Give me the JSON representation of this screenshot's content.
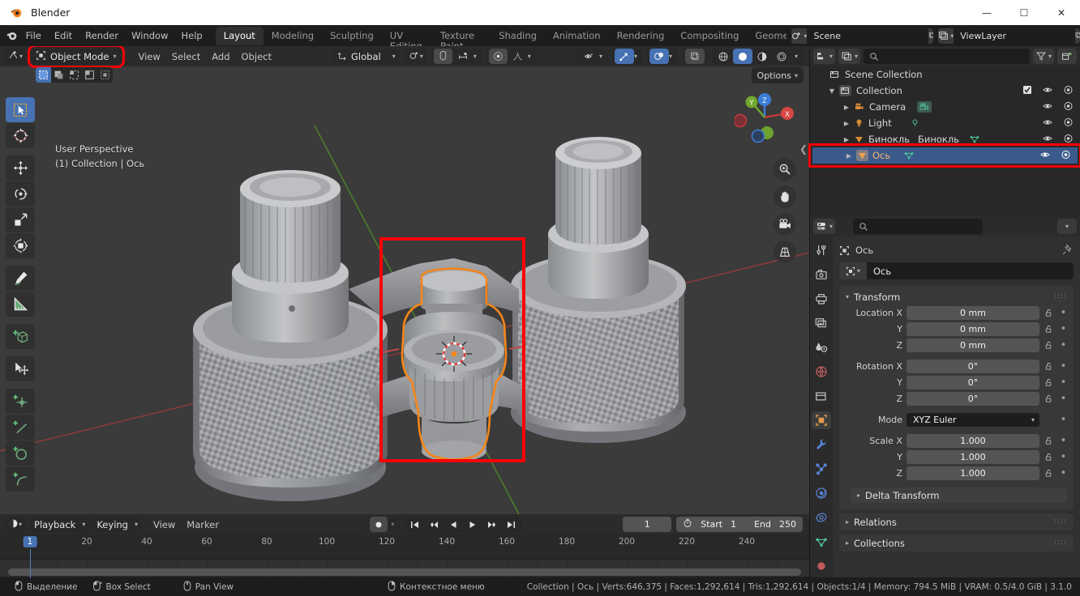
{
  "window": {
    "title": "Blender",
    "controls": {
      "minimize": "—",
      "maximize": "☐",
      "close": "✕"
    }
  },
  "topbar": {
    "menus": [
      "File",
      "Edit",
      "Render",
      "Window",
      "Help"
    ],
    "workspaces": [
      {
        "label": "Layout",
        "active": true
      },
      {
        "label": "Modeling",
        "active": false
      },
      {
        "label": "Sculpting",
        "active": false
      },
      {
        "label": "UV Editing",
        "active": false
      },
      {
        "label": "Texture Paint",
        "active": false
      },
      {
        "label": "Shading",
        "active": false
      },
      {
        "label": "Animation",
        "active": false
      },
      {
        "label": "Rendering",
        "active": false
      },
      {
        "label": "Compositing",
        "active": false
      },
      {
        "label": "Geome",
        "active": false
      }
    ],
    "scene": {
      "name": "Scene",
      "new_label": "⧉",
      "unlink_label": "✕"
    },
    "viewlayer": {
      "name": "ViewLayer",
      "new_label": "⧉",
      "unlink_label": "✕"
    }
  },
  "viewport": {
    "mode": "Object Mode",
    "menus": [
      "View",
      "Select",
      "Add",
      "Object"
    ],
    "transform_orientation": "Global",
    "options_label": "Options",
    "overlay_line1": "User Perspective",
    "overlay_line2": "(1) Collection | Ось",
    "gizmo_axes": {
      "x": "X",
      "y": "Y",
      "z": "Z"
    },
    "highlight_color": "#fb0007",
    "selection_outline_color": "#f5861a"
  },
  "timeline": {
    "editor_menus": [
      "Playback",
      "Keying",
      "View",
      "Marker"
    ],
    "current_frame": "1",
    "start_label": "Start",
    "start_value": "1",
    "end_label": "End",
    "end_value": "250",
    "ticks": [
      "20",
      "40",
      "60",
      "80",
      "100",
      "120",
      "140",
      "160",
      "180",
      "200",
      "220",
      "240"
    ],
    "playhead_label": "1"
  },
  "outliner": {
    "search_placeholder": "",
    "rows": [
      {
        "label": "Scene Collection",
        "icon": "collection-icon",
        "depth": 0,
        "selected": false,
        "has_expand": false,
        "checkbox": false,
        "eye": false,
        "camera": false
      },
      {
        "label": "Collection",
        "icon": "collection-icon",
        "depth": 1,
        "selected": false,
        "has_expand": true,
        "checkbox": true,
        "eye": true,
        "camera": true
      },
      {
        "label": "Camera",
        "icon": "camera-object-icon",
        "depth": 2,
        "selected": false,
        "has_expand": true,
        "checkbox": false,
        "eye": true,
        "camera": true,
        "data_icon": "camera-data-icon"
      },
      {
        "label": "Light",
        "icon": "light-object-icon",
        "depth": 2,
        "selected": false,
        "has_expand": true,
        "checkbox": false,
        "eye": true,
        "camera": true,
        "data_icon": "light-data-icon"
      },
      {
        "label": "Бинокль",
        "sublabel": "Бинокль",
        "icon": "mesh-object-icon",
        "depth": 2,
        "selected": false,
        "has_expand": true,
        "checkbox": false,
        "eye": true,
        "camera": true,
        "data_icon": "mesh-data-icon"
      },
      {
        "label": "Ось",
        "icon": "mesh-object-icon",
        "depth": 2,
        "selected": true,
        "has_expand": true,
        "checkbox": false,
        "eye": true,
        "camera": true,
        "data_icon": "mesh-data-icon"
      }
    ]
  },
  "properties": {
    "breadcrumb_object": "Ось",
    "name_value": "Ось",
    "search_placeholder": "",
    "transform": {
      "title": "Transform",
      "rows": [
        {
          "label": "Location X",
          "value": "0 mm"
        },
        {
          "label": "Y",
          "value": "0 mm"
        },
        {
          "label": "Z",
          "value": "0 mm"
        }
      ],
      "rotation": [
        {
          "label": "Rotation X",
          "value": "0°"
        },
        {
          "label": "Y",
          "value": "0°"
        },
        {
          "label": "Z",
          "value": "0°"
        }
      ],
      "mode_label": "Mode",
      "mode_value": "XYZ Euler",
      "scale": [
        {
          "label": "Scale X",
          "value": "1.000"
        },
        {
          "label": "Y",
          "value": "1.000"
        },
        {
          "label": "Z",
          "value": "1.000"
        }
      ],
      "delta_label": "Delta Transform"
    },
    "panels": [
      "Relations",
      "Collections"
    ]
  },
  "statusbar": {
    "hints": [
      {
        "icon": "mouse-left-icon",
        "label": "Выделение"
      },
      {
        "icon": "mouse-left-drag-icon",
        "label": "Box Select"
      },
      {
        "icon": "mouse-middle-icon",
        "label": "Pan View"
      },
      {
        "icon": "mouse-right-icon",
        "label": "Контекстное меню"
      }
    ],
    "stats": "Collection | Ось | Verts:646,375 | Faces:1,292,614 | Tris:1,292,614 | Objects:1/4 | Memory: 794.5 MiB | VRAM: 0.5/4.0 GiB | 3.1.0"
  }
}
